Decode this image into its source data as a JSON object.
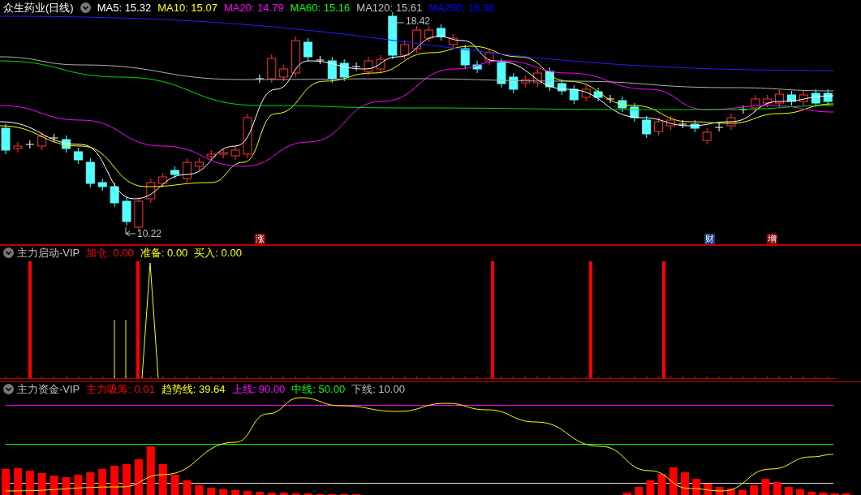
{
  "price_panel": {
    "title": "众生药业(日线)",
    "indicators": [
      {
        "label": "MA5: 15.32",
        "color": "#ffffff"
      },
      {
        "label": "MA10: 15.07",
        "color": "#ffff00"
      },
      {
        "label": "MA20: 14.79",
        "color": "#ff00ff"
      },
      {
        "label": "MA60: 15.16",
        "color": "#00ff00"
      },
      {
        "label": "MA120: 15.61",
        "color": "#c0c0c0"
      },
      {
        "label": "MA250: 16.38",
        "color": "#0000ff"
      }
    ],
    "high_label": "18.42",
    "low_label": "10.22",
    "event_markers": [
      {
        "text": "涨",
        "color": "#8b0000"
      },
      {
        "text": "财",
        "color": "#1e3f80"
      },
      {
        "text": "增",
        "color": "#8b0000"
      }
    ]
  },
  "panels": [
    {
      "title": "主力启动-VIP",
      "indicators": [
        {
          "label": "加仓: 0.00",
          "color": "#ff0000"
        },
        {
          "label": "准备: 0.00",
          "color": "#ffff00"
        },
        {
          "label": "买入: 0.00",
          "color": "#ffff00"
        }
      ]
    },
    {
      "title": "主力资金-VIP",
      "indicators": [
        {
          "label": "主力吸筹: 0.01",
          "color": "#ff0000"
        },
        {
          "label": "趋势线: 39.64",
          "color": "#ffff00"
        },
        {
          "label": "上线: 90.00",
          "color": "#ff00ff"
        },
        {
          "label": "中线: 50.00",
          "color": "#00ff00"
        },
        {
          "label": "下线: 10.00",
          "color": "#c0c0c0"
        }
      ]
    }
  ]
}
